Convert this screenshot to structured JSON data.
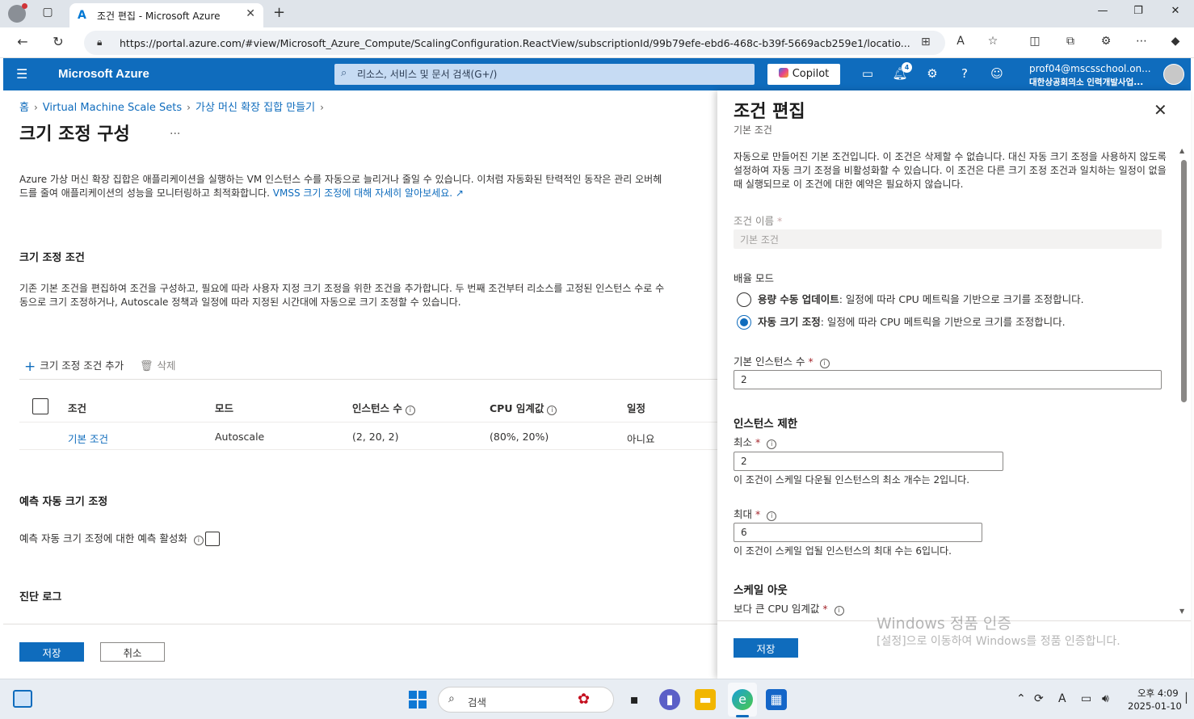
{
  "browser": {
    "tab_title": "조건 편집 - Microsoft Azure",
    "url": "https://portal.azure.com/#view/Microsoft_Azure_Compute/ScalingConfiguration.ReactView/subscriptionId/99b79efe-ebd6-468c-b39f-5669acb259e1/locatio..."
  },
  "azure_header": {
    "brand": "Microsoft Azure",
    "search_placeholder": "리소스, 서비스 및 문서 검색(G+/)",
    "copilot_label": "Copilot",
    "notification_count": "4",
    "account_name": "prof04@mscsschool.on...",
    "account_org": "대한상공회의소 인력개발사업..."
  },
  "main": {
    "breadcrumb": [
      "홈",
      "Virtual Machine Scale Sets",
      "가상 머신 확장 집합 만들기"
    ],
    "title": "크기 조정 구성",
    "more": "...",
    "intro_text": "Azure 가상 머신 확장 집합은 애플리케이션을 실행하는 VM 인스턴스 수를 자동으로 늘리거나 줄일 수 있습니다. 이처럼 자동화된 탄력적인 동작은 관리 오버헤드를 줄여 애플리케이션의 성능을 모니터링하고 최적화합니다.",
    "intro_link": "VMSS 크기 조정에 대해 자세히 알아보세요.",
    "conditions_heading": "크기 조정 조건",
    "conditions_text": "기존 기본 조건을 편집하여 조건을 구성하고, 필요에 따라 사용자 지정 크기 조정을 위한 조건을 추가합니다. 두 번째 조건부터 리소스를 고정된 인스턴스 수로 수동으로 크기 조정하거나, Autoscale 정책과 일정에 따라 지정된 시간대에 자동으로 크기 조정할 수 있습니다.",
    "add_condition": "크기 조정 조건 추가",
    "delete": "삭제",
    "table": {
      "headers": [
        "조건",
        "모드",
        "인스턴스 수",
        "CPU 임계값",
        "일정"
      ],
      "rows": [
        {
          "condition": "기본 조건",
          "mode": "Autoscale",
          "instances": "(2, 20, 2)",
          "cpu": "(80%, 20%)",
          "schedule": "아니요"
        }
      ]
    },
    "predictive_heading": "예측 자동 크기 조정",
    "predictive_label": "예측 자동 크기 조정에 대한 예측 활성화",
    "diag_heading": "진단 로그",
    "save": "저장",
    "cancel": "취소"
  },
  "panel": {
    "title": "조건 편집",
    "subtitle": "기본 조건",
    "description": "자동으로 만들어진 기본 조건입니다. 이 조건은 삭제할 수 없습니다. 대신 자동 크기 조정을 사용하지 않도록 설정하여 자동 크기 조정을 비활성화할 수 있습니다. 이 조건은 다른 크기 조정 조건과 일치하는 일정이 없을 때 실행되므로 이 조건에 대한 예약은 필요하지 않습니다.",
    "condition_name_label": "조건 이름",
    "condition_name_value": "기본 조건",
    "scale_mode_label": "배율 모드",
    "manual_bold": "용량 수동 업데이트",
    "manual_desc": ": 일정에 따라 CPU 메트릭을 기반으로 크기를 조정합니다.",
    "auto_bold": "자동 크기 조정",
    "auto_desc": ": 일정에 따라 CPU 메트릭을 기반으로 크기를 조정합니다.",
    "default_instances_label": "기본 인스턴스 수",
    "default_instances_value": "2",
    "limits_heading": "인스턴스 제한",
    "min_label": "최소",
    "min_value": "2",
    "min_hint": "이 조건이 스케일 다운될 인스턴스의 최소 개수는 2입니다.",
    "max_label": "최대",
    "max_value": "6",
    "max_hint": "이 조건이 스케일 업될 인스턴스의 최대 수는 6입니다.",
    "scaleout_heading": "스케일 아웃",
    "cpu_threshold_label": "보다 큰 CPU 임계값",
    "save": "저장",
    "watermark_title": "Windows 정품 인증",
    "watermark_text": "[설정]으로 이동하여 Windows를 정품 인증합니다."
  },
  "taskbar": {
    "search_label": "검색",
    "time": "오후 4:09",
    "date": "2025-01-10"
  },
  "colors": {
    "azure_header": "#0f6cbd",
    "primary": "#0f6cbd",
    "link": "#0f6cbd"
  }
}
